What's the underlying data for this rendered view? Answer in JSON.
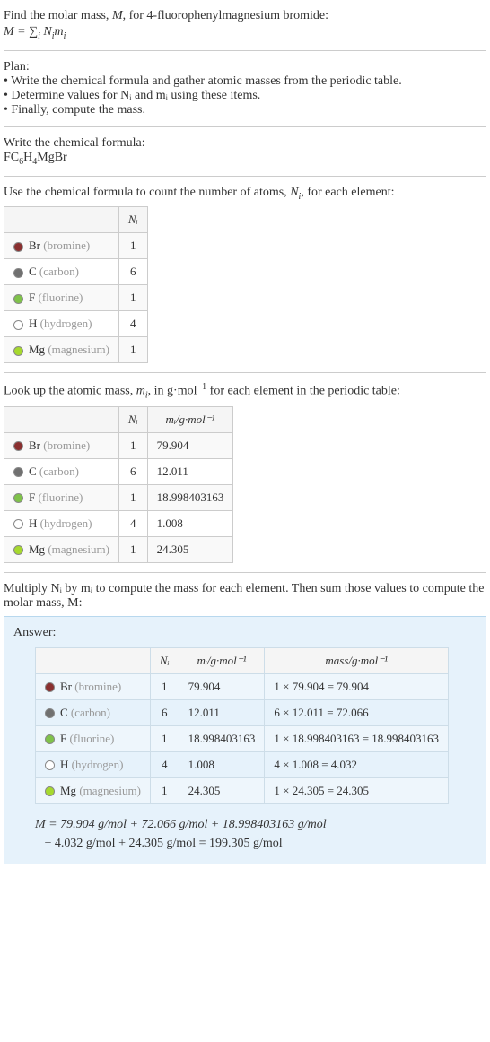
{
  "intro": {
    "line1_a": "Find the molar mass, ",
    "line1_b": ", for 4-fluorophenylmagnesium bromide:",
    "M": "M",
    "eq": "M = ∑",
    "eq_sub": "i",
    "eq_tail": " N",
    "eq_tail2": "m"
  },
  "plan": {
    "title": "Plan:",
    "items": [
      "• Write the chemical formula and gather atomic masses from the periodic table.",
      "• Determine values for Nᵢ and mᵢ using these items.",
      "• Finally, compute the mass."
    ]
  },
  "step_formula": {
    "title": "Write the chemical formula:",
    "formula_parts": [
      "FC",
      "6",
      "H",
      "4",
      "MgBr"
    ]
  },
  "step_count": {
    "title_a": "Use the chemical formula to count the number of atoms, ",
    "title_b": ", for each element:",
    "N_label": "N",
    "i_label": "i",
    "header": "Nᵢ",
    "rows": [
      {
        "color": "#8a3030",
        "sym": "Br",
        "name": "(bromine)",
        "n": "1"
      },
      {
        "color": "#707070",
        "sym": "C",
        "name": "(carbon)",
        "n": "6"
      },
      {
        "color": "#7fc24a",
        "sym": "F",
        "name": "(fluorine)",
        "n": "1"
      },
      {
        "color": "#ffffff",
        "sym": "H",
        "name": "(hydrogen)",
        "n": "4"
      },
      {
        "color": "#a6d92e",
        "sym": "Mg",
        "name": "(magnesium)",
        "n": "1"
      }
    ]
  },
  "step_mass": {
    "title_a": "Look up the atomic mass, ",
    "title_b": ", in g·mol",
    "title_c": " for each element in the periodic table:",
    "m_label": "m",
    "neg1": "−1",
    "headers": [
      "Nᵢ",
      "mᵢ/g·mol⁻¹"
    ],
    "rows": [
      {
        "color": "#8a3030",
        "sym": "Br",
        "name": "(bromine)",
        "n": "1",
        "m": "79.904"
      },
      {
        "color": "#707070",
        "sym": "C",
        "name": "(carbon)",
        "n": "6",
        "m": "12.011"
      },
      {
        "color": "#7fc24a",
        "sym": "F",
        "name": "(fluorine)",
        "n": "1",
        "m": "18.998403163"
      },
      {
        "color": "#ffffff",
        "sym": "H",
        "name": "(hydrogen)",
        "n": "4",
        "m": "1.008"
      },
      {
        "color": "#a6d92e",
        "sym": "Mg",
        "name": "(magnesium)",
        "n": "1",
        "m": "24.305"
      }
    ]
  },
  "step_compute": {
    "title": "Multiply Nᵢ by mᵢ to compute the mass for each element. Then sum those values to compute the molar mass, M:"
  },
  "answer": {
    "label": "Answer:",
    "headers": [
      "Nᵢ",
      "mᵢ/g·mol⁻¹",
      "mass/g·mol⁻¹"
    ],
    "rows": [
      {
        "color": "#8a3030",
        "sym": "Br",
        "name": "(bromine)",
        "n": "1",
        "m": "79.904",
        "mass": "1 × 79.904 = 79.904"
      },
      {
        "color": "#707070",
        "sym": "C",
        "name": "(carbon)",
        "n": "6",
        "m": "12.011",
        "mass": "6 × 12.011 = 72.066"
      },
      {
        "color": "#7fc24a",
        "sym": "F",
        "name": "(fluorine)",
        "n": "1",
        "m": "18.998403163",
        "mass": "1 × 18.998403163 = 18.998403163"
      },
      {
        "color": "#ffffff",
        "sym": "H",
        "name": "(hydrogen)",
        "n": "4",
        "m": "1.008",
        "mass": "4 × 1.008 = 4.032"
      },
      {
        "color": "#a6d92e",
        "sym": "Mg",
        "name": "(magnesium)",
        "n": "1",
        "m": "24.305",
        "mass": "1 × 24.305 = 24.305"
      }
    ],
    "final1": "M = 79.904 g/mol + 72.066 g/mol + 18.998403163 g/mol",
    "final2": "+ 4.032 g/mol + 24.305 g/mol = 199.305 g/mol"
  }
}
